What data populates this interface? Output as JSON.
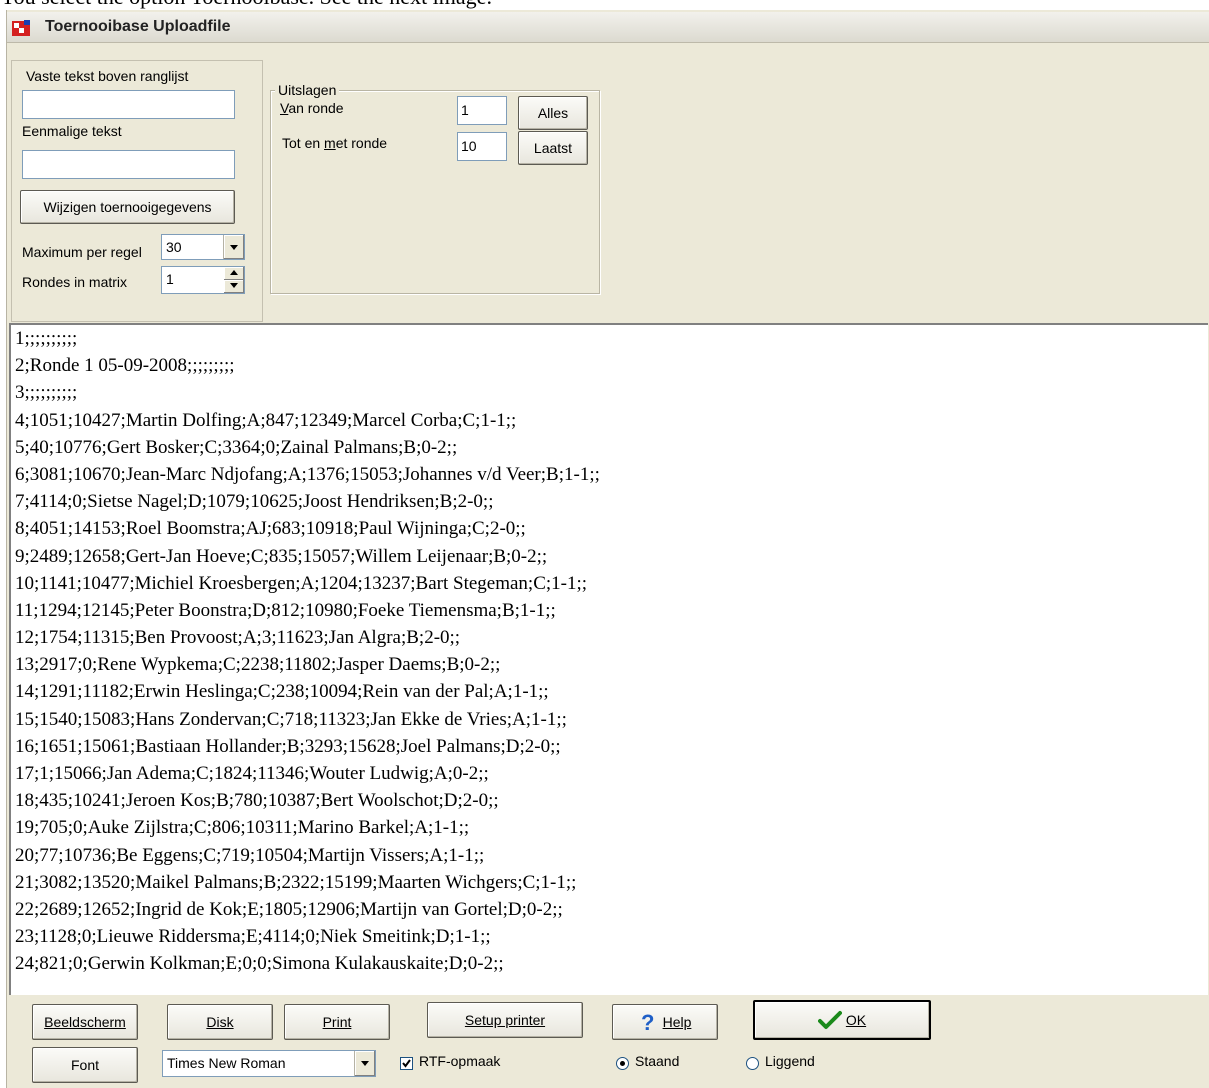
{
  "caption": "You select the option Toernooibase. See the next image.",
  "window": {
    "title": "Toernooibase Uploadfile"
  },
  "left_panel": {
    "fixed_text_label": "Vaste tekst boven ranglijst",
    "fixed_text_value": "",
    "onetime_text_label": "Eenmalige tekst",
    "onetime_text_value": "",
    "edit_tournament_button": "Wijzigen toernooigegevens",
    "max_per_line_label": "Maximum per regel",
    "max_per_line_value": "30",
    "rounds_matrix_label": "Rondes in matrix",
    "rounds_matrix_value": "1"
  },
  "results_group": {
    "title": "Uitslagen",
    "from_round_label": "Van ronde",
    "from_round_value": "1",
    "all_button": "Alles",
    "to_round_label": "Tot en met ronde",
    "to_round_value": "10",
    "last_button": "Laatst"
  },
  "memo": {
    "lines": [
      "1;;;;;;;;;;",
      "2;Ronde 1  05-09-2008;;;;;;;;;",
      "3;;;;;;;;;;",
      "4;1051;10427;Martin  Dolfing;A;847;12349;Marcel  Corba;C;1-1;;",
      "5;40;10776;Gert  Bosker;C;3364;0;Zainal  Palmans;B;0-2;;",
      "6;3081;10670;Jean-Marc  Ndjofang;A;1376;15053;Johannes v/d Veer;B;1-1;;",
      "7;4114;0;Sietse Nagel;D;1079;10625;Joost  Hendriksen;B;2-0;;",
      "8;4051;14153;Roel  Boomstra;AJ;683;10918;Paul  Wijninga;C;2-0;;",
      "9;2489;12658;Gert-Jan  Hoeve;C;835;15057;Willem  Leijenaar;B;0-2;;",
      "10;1141;10477;Michiel  Kroesbergen;A;1204;13237;Bart  Stegeman;C;1-1;;",
      "11;1294;12145;Peter  Boonstra;D;812;10980;Foeke  Tiemensma;B;1-1;;",
      "12;1754;11315;Ben  Provoost;A;3;11623;Jan  Algra;B;2-0;;",
      "13;2917;0;Rene  Wypkema;C;2238;11802;Jasper  Daems;B;0-2;;",
      "14;1291;11182;Erwin  Heslinga;C;238;10094;Rein van der Pal;A;1-1;;",
      "15;1540;15083;Hans  Zondervan;C;718;11323;Jan Ekke de Vries;A;1-1;;",
      "16;1651;15061;Bastiaan  Hollander;B;3293;15628;Joel  Palmans;D;2-0;;",
      "17;1;15066;Jan  Adema;C;1824;11346;Wouter  Ludwig;A;0-2;;",
      "18;435;10241;Jeroen  Kos;B;780;10387;Bert  Woolschot;D;2-0;;",
      "19;705;0;Auke  Zijlstra;C;806;10311;Marino  Barkel;A;1-1;;",
      "20;77;10736;Be  Eggens;C;719;10504;Martijn  Vissers;A;1-1;;",
      "21;3082;13520;Maikel  Palmans;B;2322;15199;Maarten  Wichgers;C;1-1;;",
      "22;2689;12652;Ingrid de Kok;E;1805;12906;Martijn van Gortel;D;0-2;;",
      "23;1128;0;Lieuwe  Riddersma;E;4114;0;Niek  Smeitink;D;1-1;;",
      "24;821;0;Gerwin  Kolkman;E;0;0;Simona  Kulakauskaite;D;0-2;;"
    ]
  },
  "bottom": {
    "screen_button": "Beeldscherm",
    "disk_button": "Disk",
    "print_button": "Print",
    "setup_printer_button": "Setup printer",
    "help_button": "Help",
    "ok_button": "OK",
    "font_button": "Font",
    "font_select_value": "Times New Roman",
    "rtf_label": "RTF-opmaak",
    "rtf_checked": true,
    "portrait_label": "Staand",
    "portrait_selected": true,
    "landscape_label": "Liggend",
    "landscape_selected": false
  },
  "colors": {
    "window_bg": "#ece9d8",
    "help_icon": "#1f5fc7",
    "ok_check": "#1b8a1b"
  }
}
